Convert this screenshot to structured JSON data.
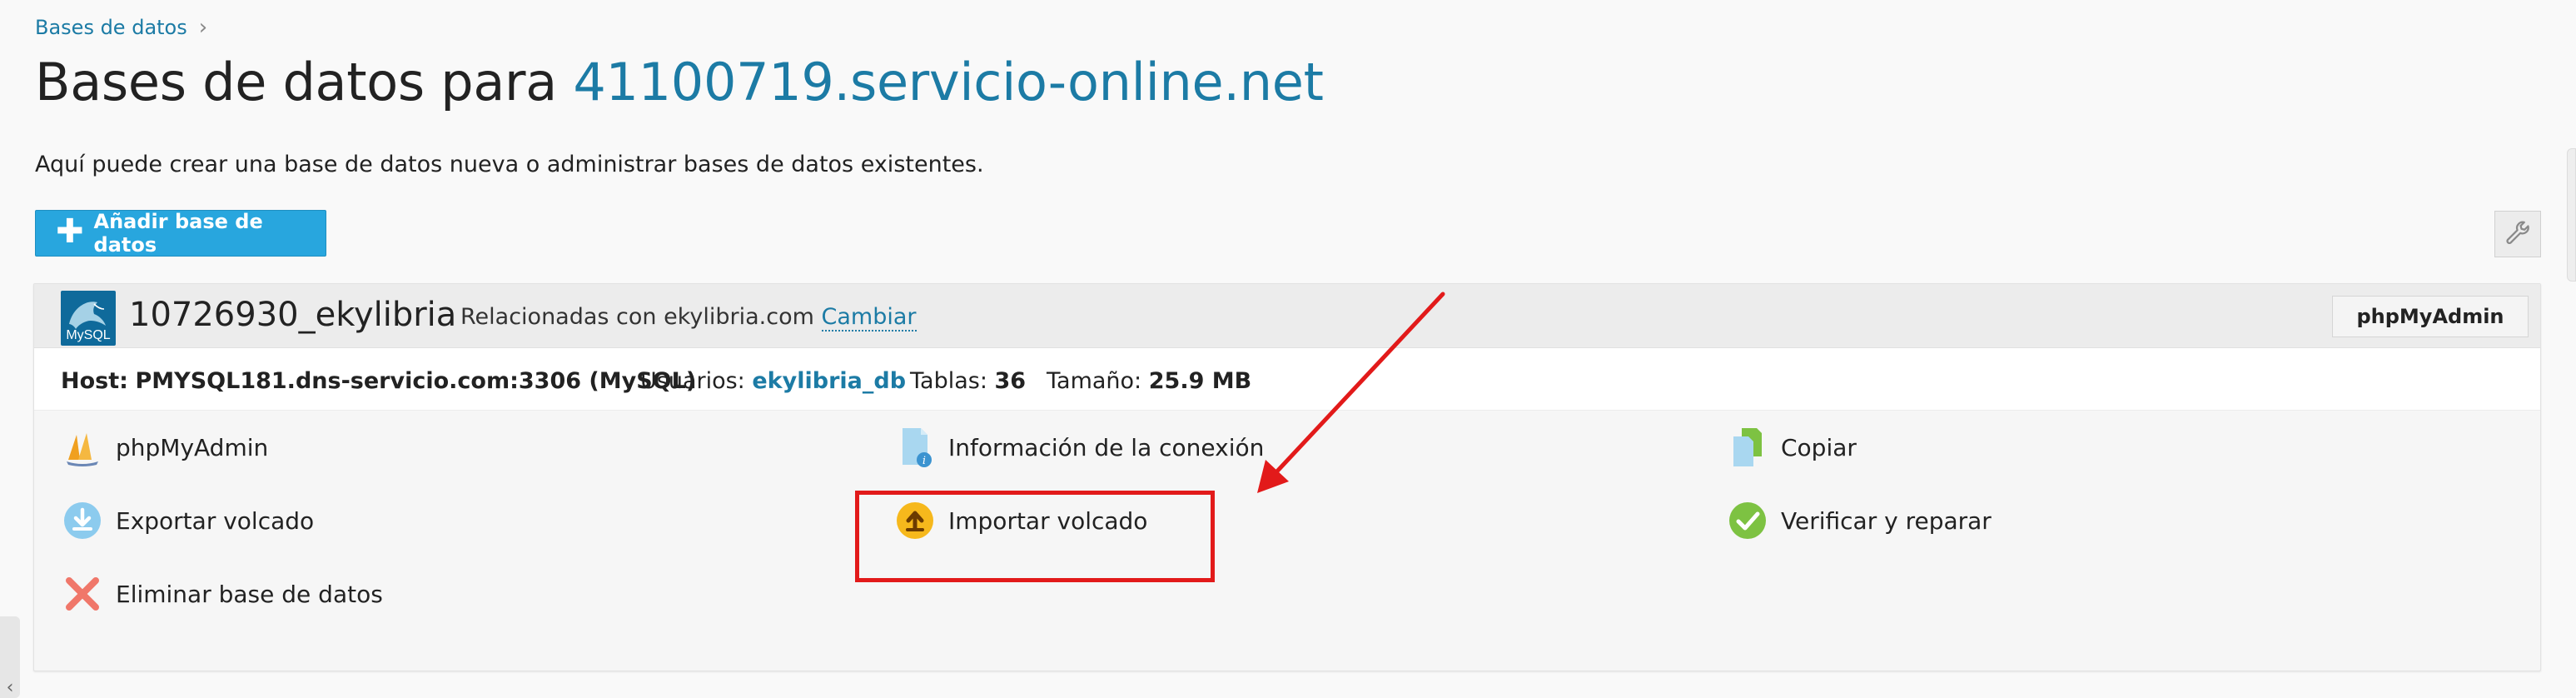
{
  "breadcrumb": {
    "label": "Bases de datos"
  },
  "header": {
    "title_prefix": "Bases de datos para",
    "domain": "41100719.servicio-online.net",
    "intro": "Aquí puede crear una base de datos nueva o administrar bases de datos existentes."
  },
  "toolbar": {
    "add_label": "Añadir base de datos"
  },
  "database": {
    "name": "10726930_ekylibria",
    "logo_text": "MySQL",
    "related_text": "Relacionadas con ekylibria.com",
    "change_label": "Cambiar",
    "pma_button": "phpMyAdmin",
    "info": {
      "host_label": "Host:",
      "host_value": "PMYSQL181.dns-servicio.com:3306 (MySQL)",
      "users_label": "Usuarios:",
      "users_value": "ekylibria_db",
      "tables_label": "Tablas:",
      "tables_value": "36",
      "size_label": "Tamaño:",
      "size_value": "25.9 MB"
    },
    "actions": {
      "phpmyadmin": "phpMyAdmin",
      "connection_info": "Información de la conexión",
      "copy": "Copiar",
      "export_dump": "Exportar volcado",
      "import_dump": "Importar volcado",
      "verify_repair": "Verificar y reparar",
      "delete_db": "Eliminar base de datos"
    }
  },
  "colors": {
    "accent": "#28a6de",
    "link": "#1c7ba5",
    "annotation": "#e21a1a"
  }
}
